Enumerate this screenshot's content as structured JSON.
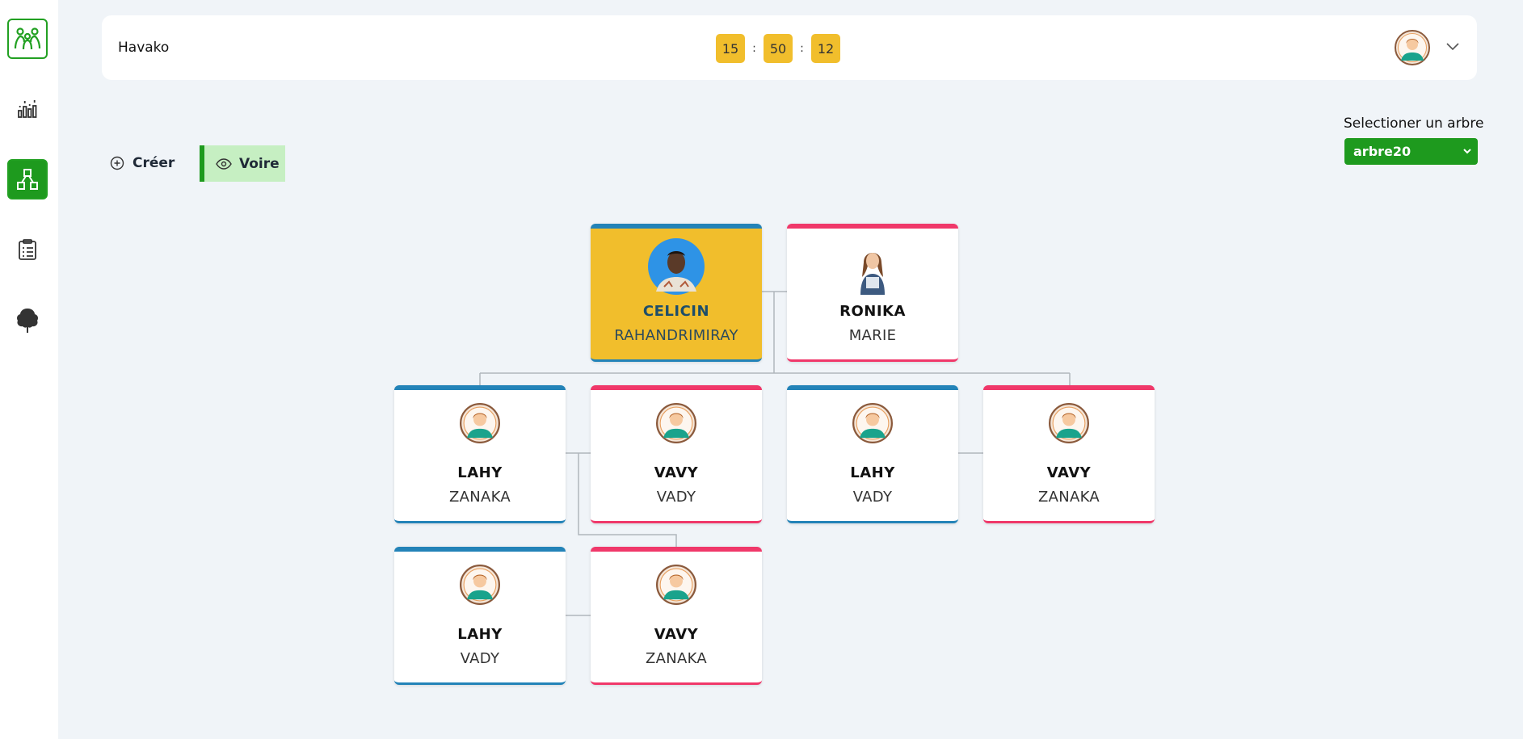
{
  "header": {
    "app_title": "Havako",
    "clock": {
      "hours": "15",
      "minutes": "50",
      "seconds": "12",
      "separator": ":"
    }
  },
  "sidebar": {
    "items": [
      {
        "icon": "family-logo-icon",
        "active": false
      },
      {
        "icon": "stats-chart-icon",
        "active": false
      },
      {
        "icon": "tree-structure-icon",
        "active": true
      },
      {
        "icon": "clipboard-list-icon",
        "active": false
      },
      {
        "icon": "tree-icon",
        "active": false
      }
    ]
  },
  "toolbar": {
    "create_label": "Créer",
    "view_label": "Voire"
  },
  "tree_select": {
    "label": "Selectioner un arbre",
    "value": "arbre20"
  },
  "colors": {
    "accent_green": "#1e9a1e",
    "clock_yellow": "#f1be2c",
    "male_blue": "#2383b8",
    "female_pink": "#f0386a"
  },
  "members": [
    {
      "first": "CELICIN",
      "last": "RAHANDRIMIRAY",
      "gender": "male",
      "root": true
    },
    {
      "first": "RONIKA",
      "last": "MARIE",
      "gender": "female"
    },
    {
      "first": "LAHY",
      "last": "ZANAKA",
      "gender": "male"
    },
    {
      "first": "VAVY",
      "last": "VADY",
      "gender": "female"
    },
    {
      "first": "LAHY",
      "last": "VADY",
      "gender": "male"
    },
    {
      "first": "VAVY",
      "last": "ZANAKA",
      "gender": "female"
    },
    {
      "first": "LAHY",
      "last": "VADY",
      "gender": "male"
    },
    {
      "first": "VAVY",
      "last": "ZANAKA",
      "gender": "female"
    }
  ]
}
